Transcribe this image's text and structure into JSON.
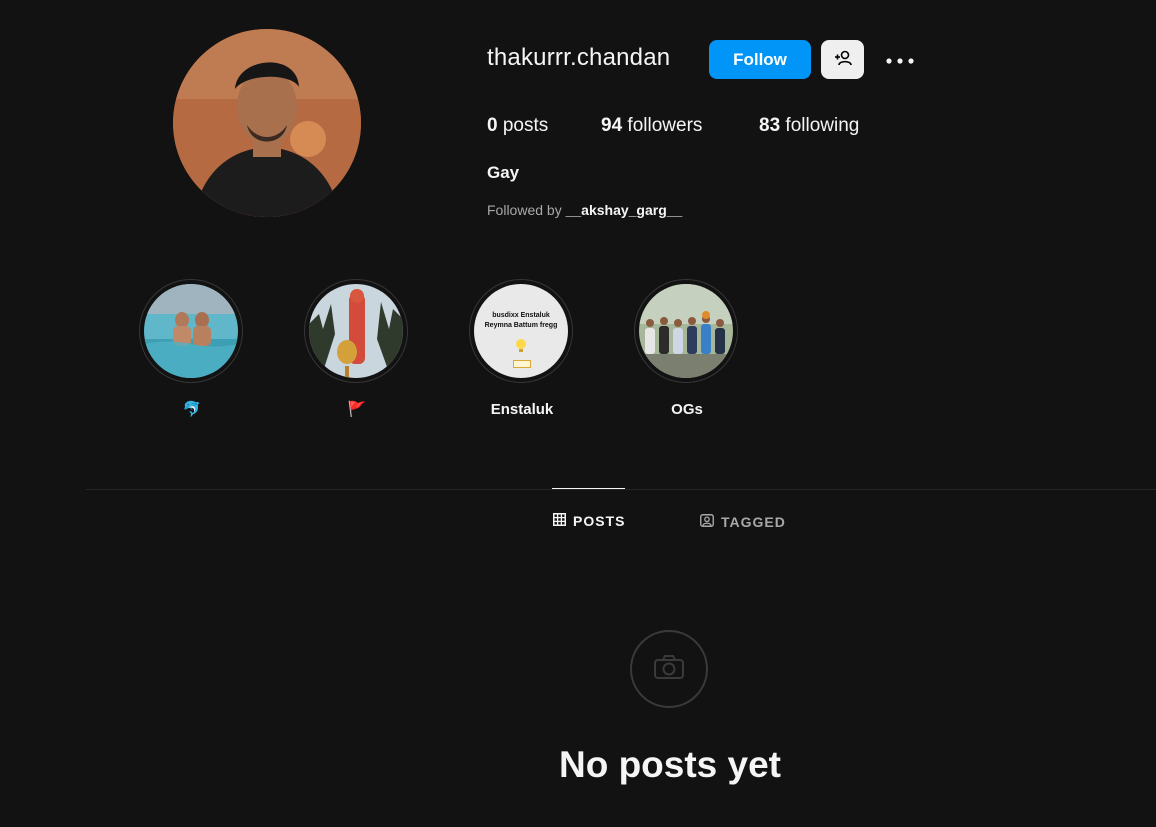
{
  "profile": {
    "username": "thakurrr.chandan",
    "follow_label": "Follow",
    "stats": {
      "posts_count": "0",
      "posts_label": "posts",
      "followers_count": "94",
      "followers_label": "followers",
      "following_count": "83",
      "following_label": "following"
    },
    "bio_name": "Gay",
    "followed_by_prefix": "Followed by",
    "followed_by_user": "__akshay_garg__"
  },
  "highlights": [
    {
      "label": "🐬",
      "label_color": "#1da1f2"
    },
    {
      "label": "🚩",
      "label_color": "#e0245e"
    },
    {
      "label": "Enstaluk",
      "thumb_text_1": "busdixx Enstaluk",
      "thumb_text_2": "Reymna Battum fregg"
    },
    {
      "label": "OGs"
    }
  ],
  "tabs": {
    "posts": "POSTS",
    "tagged": "TAGGED"
  },
  "empty_state": {
    "title": "No posts yet"
  },
  "colors": {
    "background": "#121212",
    "accent": "#0095f6",
    "muted_text": "#a8a8a8"
  }
}
